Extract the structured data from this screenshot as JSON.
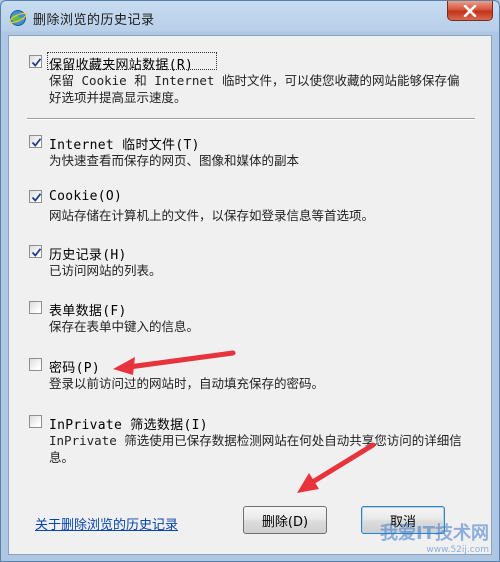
{
  "window": {
    "title": "删除浏览的历史记录"
  },
  "options": [
    {
      "label": "保留收藏夹网站数据(R)",
      "description": "保留 Cookie 和 Internet 临时文件，可以使您收藏的网站能够保存偏好选项并提高显示速度。",
      "checked": true
    },
    {
      "label": "Internet 临时文件(T)",
      "description": "为快速查看而保存的网页、图像和媒体的副本",
      "checked": true
    },
    {
      "label": "Cookie(O)",
      "description": "网站存储在计算机上的文件，以保存如登录信息等首选项。",
      "checked": true
    },
    {
      "label": "历史记录(H)",
      "description": "已访问网站的列表。",
      "checked": true
    },
    {
      "label": "表单数据(F)",
      "description": "保存在表单中键入的信息。",
      "checked": false
    },
    {
      "label": "密码(P)",
      "description": "登录以前访问过的网站时，自动填充保存的密码。",
      "checked": false
    },
    {
      "label": "InPrivate 筛选数据(I)",
      "description": "InPrivate 筛选使用已保存数据检测网站在何处自动共享您访问的详细信息。",
      "checked": false
    }
  ],
  "footer": {
    "link_text": "关于删除浏览的历史记录",
    "delete_label": "删除(D)",
    "cancel_label": "取消"
  },
  "watermark": {
    "text": "我爱IT技术网",
    "url": "www.52ij.com"
  },
  "colors": {
    "annotation_arrow": "#e8323c",
    "link": "#0645ad",
    "title_bar": "#b7cfe9"
  }
}
